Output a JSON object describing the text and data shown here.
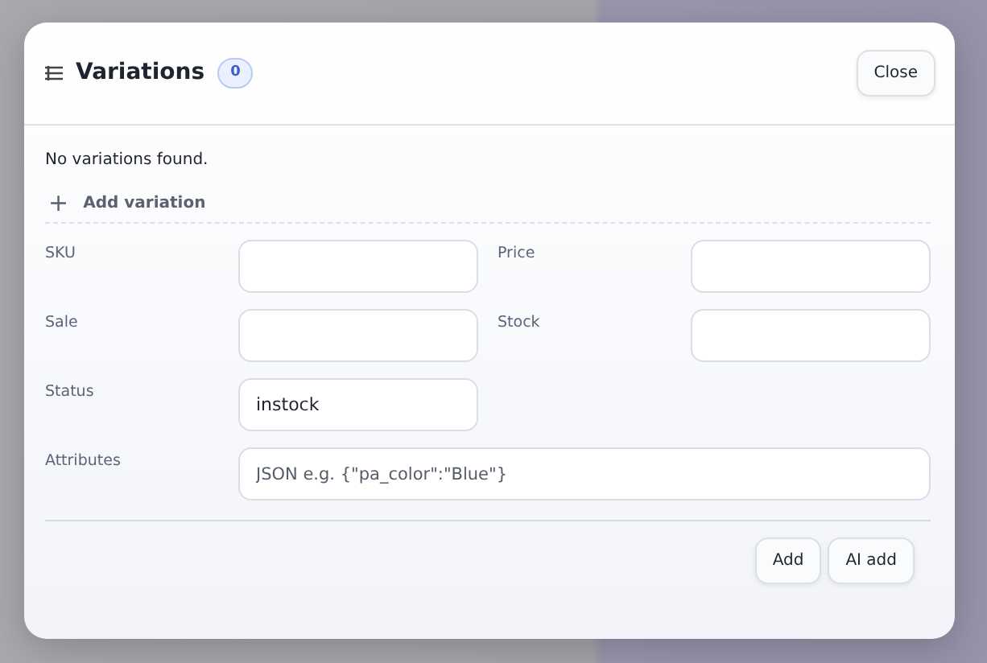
{
  "dialog": {
    "title": "Variations",
    "count": "0",
    "close_button": "Close"
  },
  "empty_message": "No variations found.",
  "add_variation": {
    "icon": "+",
    "label": "Add variation"
  },
  "fields": [
    {
      "label": "SKU"
    },
    {
      "label": "Price"
    },
    {
      "label": "Sale"
    },
    {
      "label": "Stock"
    },
    {
      "label": "Status",
      "value": "instock"
    },
    {
      "label": "Attributes",
      "placeholder": "JSON e.g. {\"pa_color\":\"Blue\"}",
      "kind": "wide"
    }
  ],
  "buttons": [
    "Add",
    "AI add"
  ]
}
